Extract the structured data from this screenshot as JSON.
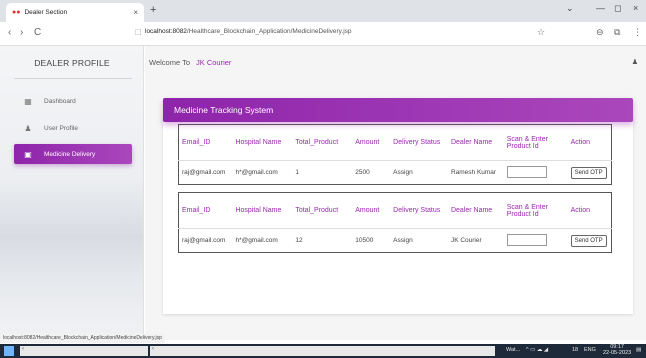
{
  "browser": {
    "tab_title": "Dealer Section",
    "tab_favicon": "●●",
    "close_glyph": "×",
    "new_tab_glyph": "+",
    "win_min": "—",
    "win_restore": "◻",
    "win_close": "×",
    "back": "‹",
    "forward": "›",
    "reload": "C",
    "url_host": "localhost:8082",
    "url_path": "/Healthcare_Blockchain_Application/MedicineDelivery.jsp",
    "status_url": "localhost:8082/Healthcare_Blockchain_Application/MedicineDelivery.jsp"
  },
  "sidebar": {
    "brand": "DEALER PROFILE",
    "items": [
      {
        "label": "Dashboard",
        "icon": "dashboard-icon",
        "active": false
      },
      {
        "label": "User Profile",
        "icon": "person-icon",
        "active": false
      },
      {
        "label": "Medicine Delivery",
        "icon": "clipboard-icon",
        "active": true
      }
    ]
  },
  "header": {
    "welcome": "Welcome To",
    "user": "JK Courier",
    "user_icon": "person-icon"
  },
  "card": {
    "title": "Medicine Tracking System"
  },
  "tables": [
    {
      "headers": [
        "Email_ID",
        "Hospital Name",
        "Total_Product",
        "Amount",
        "Delivery Status",
        "Dealer Name",
        "Scan & Enter Product Id",
        "Action"
      ],
      "row": [
        "raj@gmail.com",
        "h*@gmail.com",
        "1",
        "2500",
        "Assign",
        "Ramesh Kumar"
      ],
      "button": "Send OTP"
    },
    {
      "headers": [
        "Email_ID",
        "Hospital Name",
        "Total_Product",
        "Amount",
        "Delivery Status",
        "Dealer Name",
        "Scan & Enter Product Id",
        "Action"
      ],
      "row": [
        "raj@gmail.com",
        "h*@gmail.com",
        "12",
        "10500",
        "Assign",
        "JK Courier"
      ],
      "button": "Send OTP"
    }
  ],
  "taskbar": {
    "weather": "Wat...",
    "lang": "ENG",
    "time": "09:17",
    "date": "22-05-2023",
    "temp": "18"
  },
  "colors": {
    "accent": "#9c27b0",
    "accent_light": "#ab47bc"
  }
}
